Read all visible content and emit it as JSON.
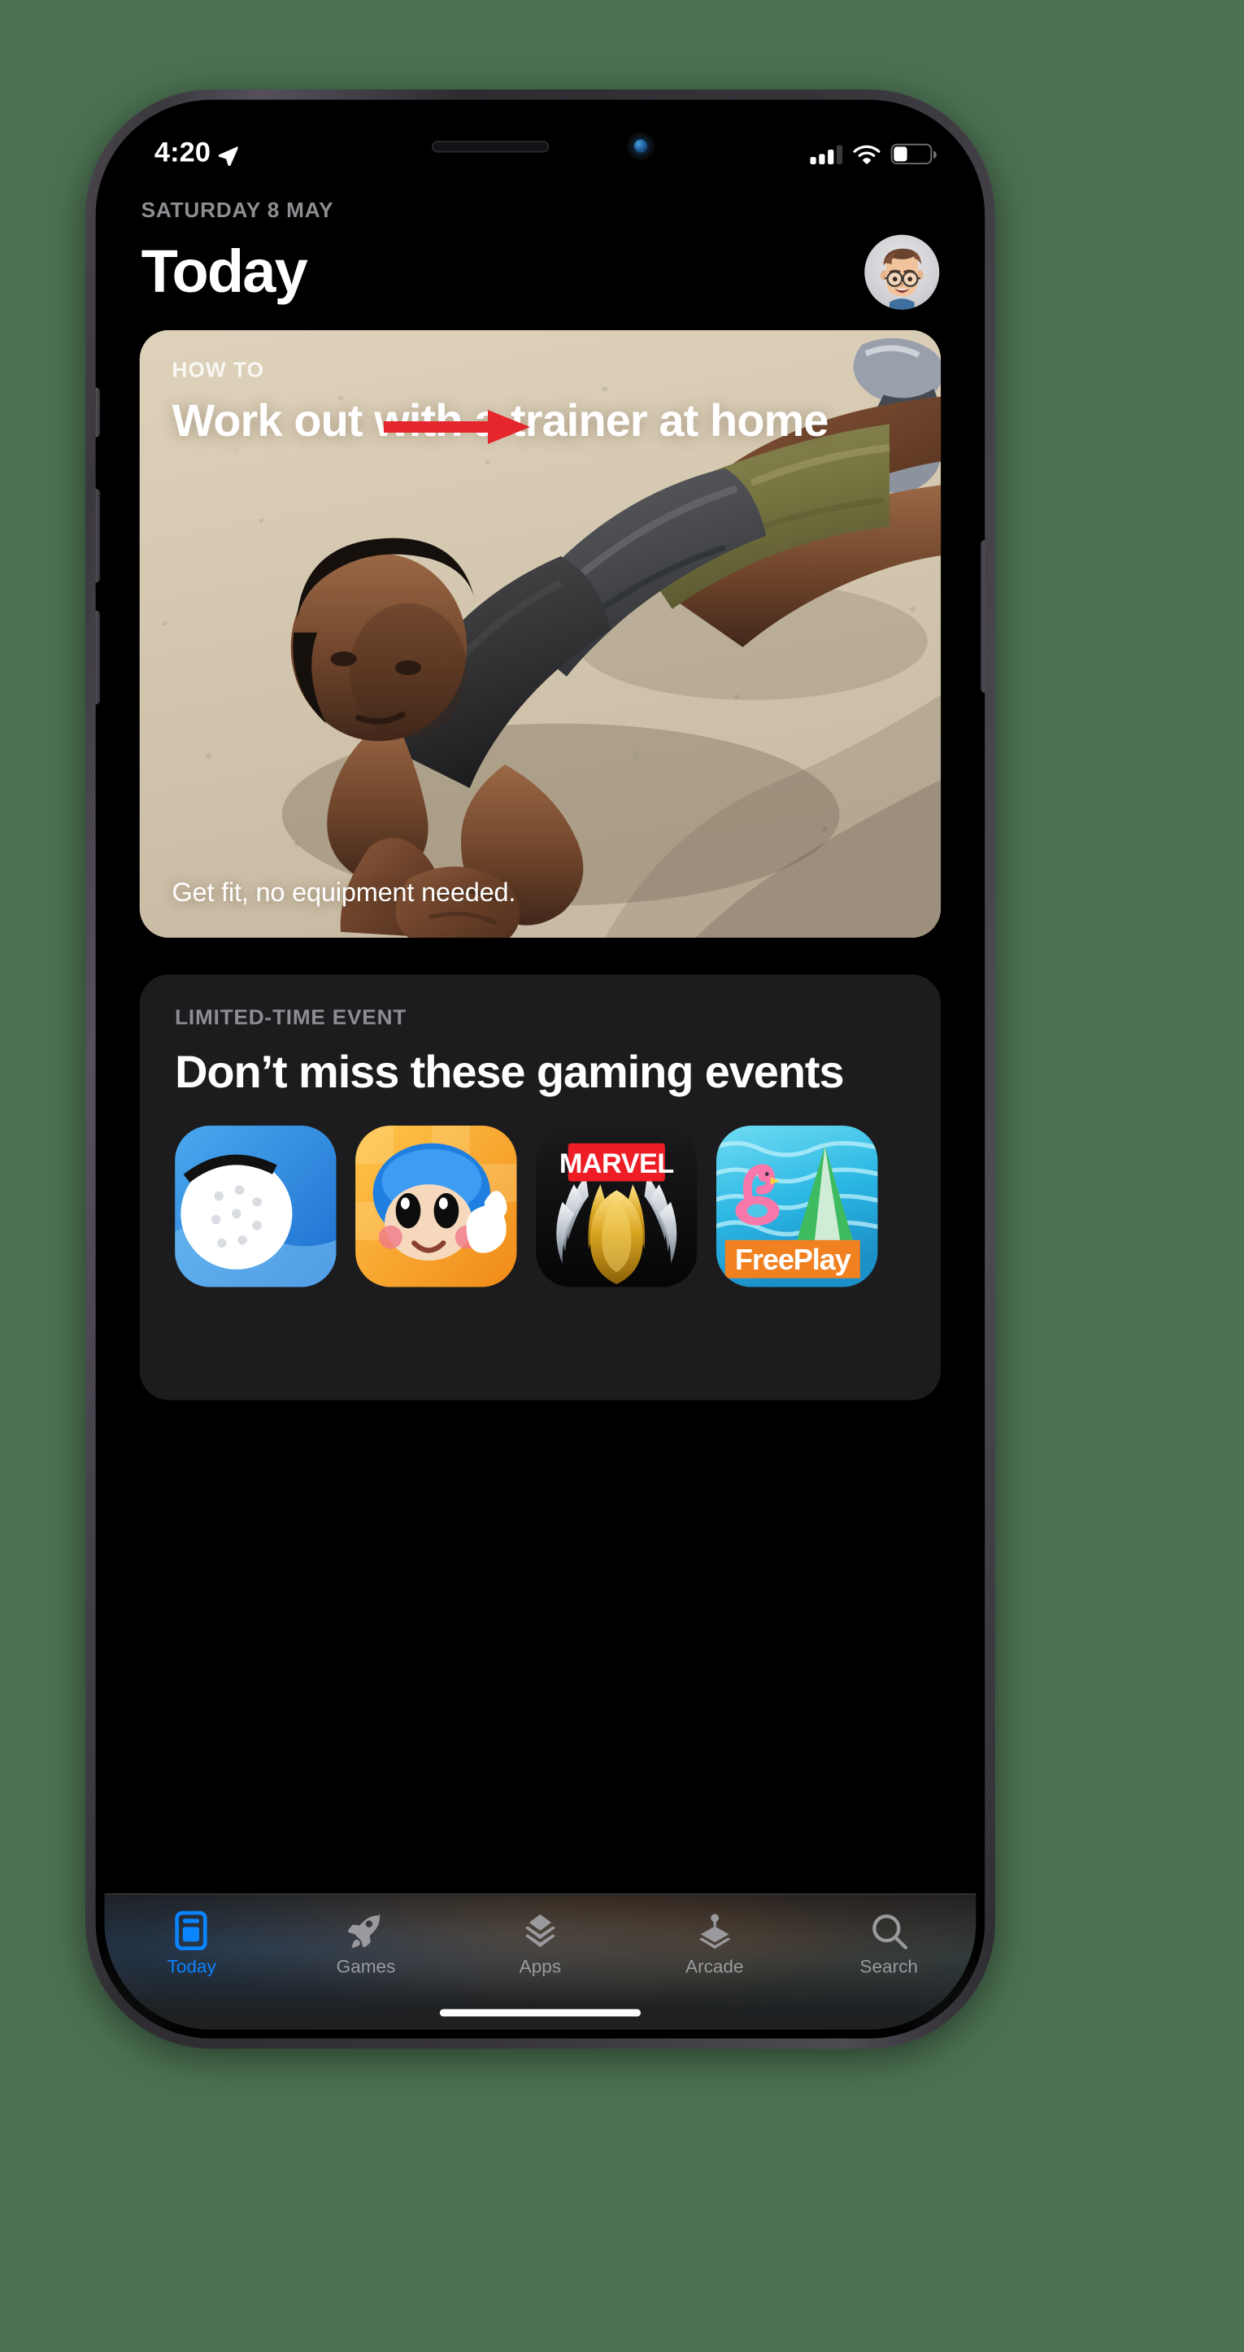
{
  "background_color": "#4b7152",
  "device": {
    "name": "iPhone",
    "frame_color": "#3a373d",
    "buttons": [
      "silent-switch",
      "volume-up",
      "volume-down",
      "side-power"
    ]
  },
  "status_bar": {
    "time": "4:20",
    "location_icon": "location-arrow-icon",
    "cellular_icon": "cellular-signal-icon",
    "cellular_bars_filled": 3,
    "cellular_bars_total": 4,
    "wifi_icon": "wifi-icon",
    "wifi_strength": "full",
    "battery_icon": "battery-icon",
    "battery_percent": 35
  },
  "header": {
    "date": "SATURDAY 8 MAY",
    "title": "Today",
    "avatar": "user-memoji-avatar"
  },
  "annotation": {
    "type": "arrow",
    "color": "#e5262c",
    "direction": "right",
    "points_to": "profile-avatar"
  },
  "cards": [
    {
      "id": "how-to",
      "eyebrow": "HOW TO",
      "title": "Work out with a trainer at home",
      "caption": "Get fit, no equipment needed.",
      "image": "man-doing-plank-on-pavement"
    },
    {
      "id": "gaming-events",
      "eyebrow": "LIMITED-TIME EVENT",
      "title": "Don’t miss these gaming events",
      "app_icons": [
        {
          "name": "golf-game-icon",
          "label": ""
        },
        {
          "name": "bomber-character-game-icon",
          "label": ""
        },
        {
          "name": "marvel-game-icon",
          "label": "MARVEL"
        },
        {
          "name": "freeplay-pool-game-icon",
          "label": "FreePlay"
        }
      ]
    }
  ],
  "tab_bar": {
    "active": "Today",
    "active_color": "#0a84ff",
    "inactive_color": "#9a9a9e",
    "tabs": [
      {
        "label": "Today",
        "icon": "today-card-icon"
      },
      {
        "label": "Games",
        "icon": "rocket-icon"
      },
      {
        "label": "Apps",
        "icon": "stacked-chevrons-icon"
      },
      {
        "label": "Arcade",
        "icon": "joystick-icon"
      },
      {
        "label": "Search",
        "icon": "magnifier-icon"
      }
    ]
  },
  "home_indicator": "home-indicator-bar"
}
